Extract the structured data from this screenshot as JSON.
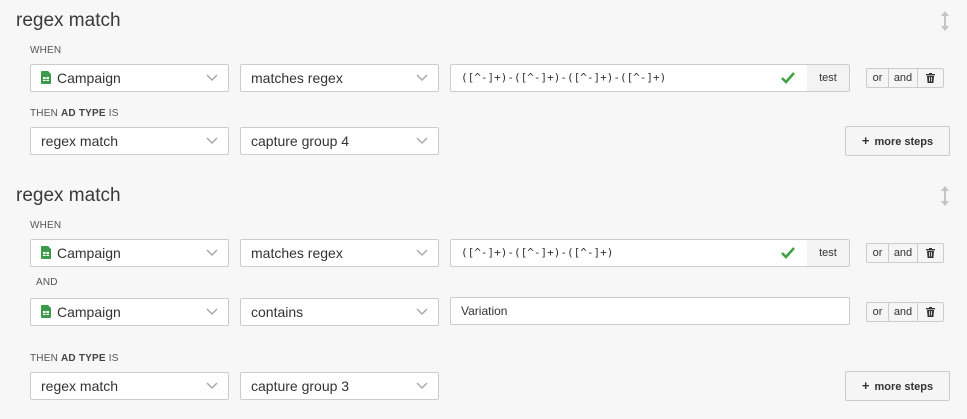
{
  "rules": [
    {
      "title": "regex match",
      "when_label": "WHEN",
      "conditions": [
        {
          "connector": "",
          "field": "Campaign",
          "operator": "matches regex",
          "value": "([^-]+)-([^-]+)-([^-]+)-([^-]+)",
          "valid": true,
          "test_label": "test",
          "or_label": "or",
          "and_label": "and"
        }
      ],
      "then_prefix": "THEN",
      "then_field": "AD TYPE",
      "then_suffix": "IS",
      "action_source": "regex match",
      "action_value": "capture group 4",
      "more_steps_label": "more steps"
    },
    {
      "title": "regex match",
      "when_label": "WHEN",
      "conditions": [
        {
          "connector": "",
          "field": "Campaign",
          "operator": "matches regex",
          "value": "([^-]+)-([^-]+)-([^-]+)",
          "valid": true,
          "test_label": "test",
          "or_label": "or",
          "and_label": "and"
        },
        {
          "connector": "AND",
          "field": "Campaign",
          "operator": "contains",
          "value": "Variation",
          "or_label": "or",
          "and_label": "and"
        }
      ],
      "then_prefix": "THEN",
      "then_field": "AD TYPE",
      "then_suffix": "IS",
      "action_source": "regex match",
      "action_value": "capture group 3",
      "more_steps_label": "more steps"
    }
  ],
  "icons": {
    "drag": "vertical-resize-icon",
    "sheet": "spreadsheet-icon",
    "chevron": "chevron-down-icon",
    "check": "checkmark-icon",
    "trash": "trash-icon",
    "plus": "plus-icon"
  },
  "colors": {
    "sheet_green": "#3a9b4a",
    "check_green": "#3fa33f"
  }
}
